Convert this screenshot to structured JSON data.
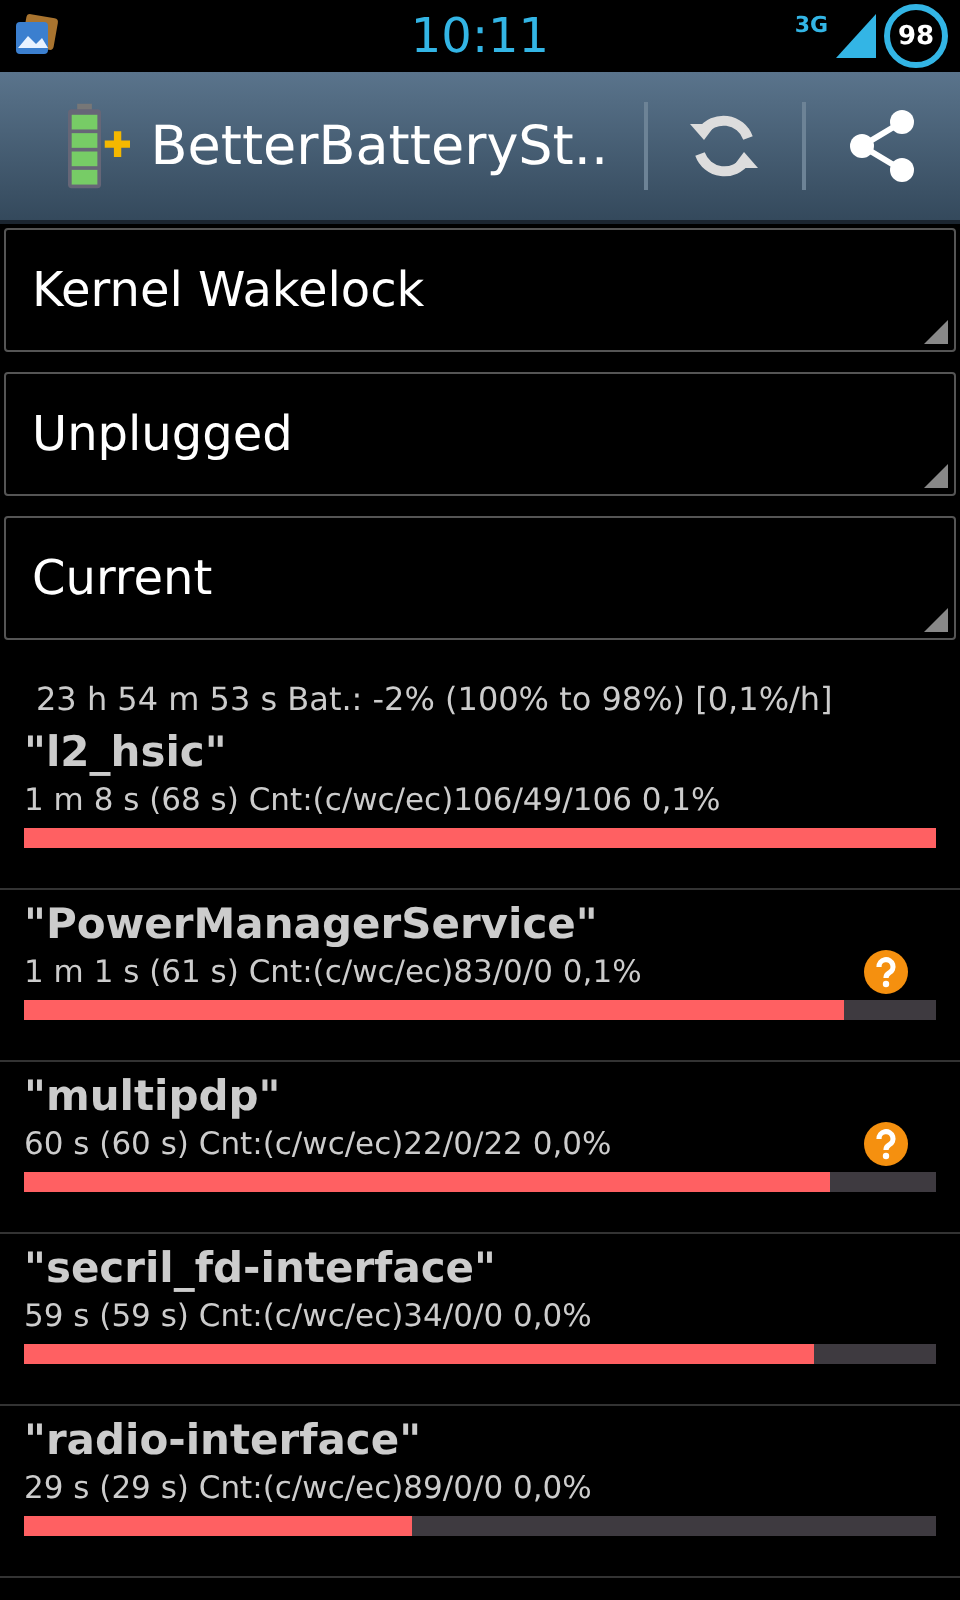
{
  "status_bar": {
    "time": "10:11",
    "network": "3G",
    "battery": "98"
  },
  "action_bar": {
    "title": "BetterBatterySt.."
  },
  "spinners": [
    {
      "value": "Kernel Wakelock"
    },
    {
      "value": "Unplugged"
    },
    {
      "value": "Current"
    }
  ],
  "summary": "23 h 54 m 53 s  Bat.: -2% (100% to 98%) [0,1%/h]",
  "wakelocks": [
    {
      "name": "\"l2_hsic\"",
      "details": "1 m 8 s  (68 s) Cnt:(c/wc/ec)106/49/106 0,1%",
      "level": 1.0,
      "help_icon": false
    },
    {
      "name": "\"PowerManagerService\"",
      "details": "1 m 1 s  (61 s) Cnt:(c/wc/ec)83/0/0 0,1%",
      "level": 0.9,
      "help_icon": true
    },
    {
      "name": "\"multipdp\"",
      "details": "60 s  (60 s) Cnt:(c/wc/ec)22/0/22 0,0%",
      "level": 0.884,
      "help_icon": true
    },
    {
      "name": "\"secril_fd-interface\"",
      "details": "59 s  (59 s) Cnt:(c/wc/ec)34/0/0 0,0%",
      "level": 0.866,
      "help_icon": false
    },
    {
      "name": "\"radio-interface\"",
      "details": "29 s  (29 s) Cnt:(c/wc/ec)89/0/0 0,0%",
      "level": 0.425,
      "help_icon": false
    }
  ]
}
